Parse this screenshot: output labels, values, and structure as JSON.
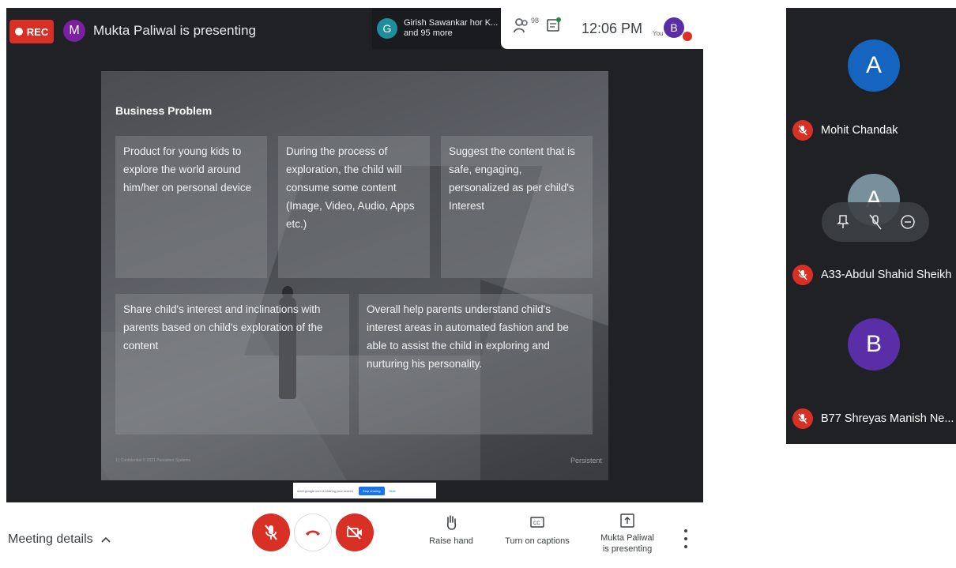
{
  "topbar": {
    "rec_label": "REC",
    "presenter_initial": "M",
    "presenting_text": "Mukta Paliwal is presenting",
    "people_chip": {
      "avatar_initial": "G",
      "line1": "Girish Sawankar hor K...",
      "line2": "and 95 more"
    },
    "participant_count": "98",
    "time": "12:06 PM",
    "self_initial": "B",
    "self_label": "You"
  },
  "slide": {
    "title": "Business Problem",
    "boxes": [
      "Product for young kids to explore the world around him/her on personal device",
      "During the process of exploration, the child will consume some content (Image, Video, Audio, Apps etc.)",
      "Suggest the content that is safe, engaging, personalized as per child's Interest",
      "Share child's interest and inclinations with parents based on child's exploration of the content",
      "Overall help parents understand child's interest areas in automated fashion and be able to assist the child in exploring and nurturing his personality."
    ],
    "footer": "1  |  Confidential © 2021 Persistent Systems",
    "logo": "Persistent"
  },
  "share_bar": {
    "message": "meet.google.com is sharing your screen.",
    "stop_label": "Stop sharing",
    "hide_label": "Hide"
  },
  "tiles": [
    {
      "initial": "A",
      "name": "Mohit Chandak",
      "color": "#1565c0"
    },
    {
      "initial": "A",
      "name": "A33-Abdul Shahid Sheikh",
      "color": "#78909c"
    },
    {
      "initial": "B",
      "name": "B77 Shreyas Manish Ne...",
      "color": "#5a2ea6"
    }
  ],
  "bottom": {
    "meeting_details": "Meeting details",
    "raise_hand": "Raise hand",
    "captions": "Turn on captions",
    "presenting_line1": "Mukta Paliwal",
    "presenting_line2": "is presenting"
  },
  "colors": {
    "danger": "#d93025",
    "dark_bg": "#202124",
    "accent": "#1a73e8"
  }
}
